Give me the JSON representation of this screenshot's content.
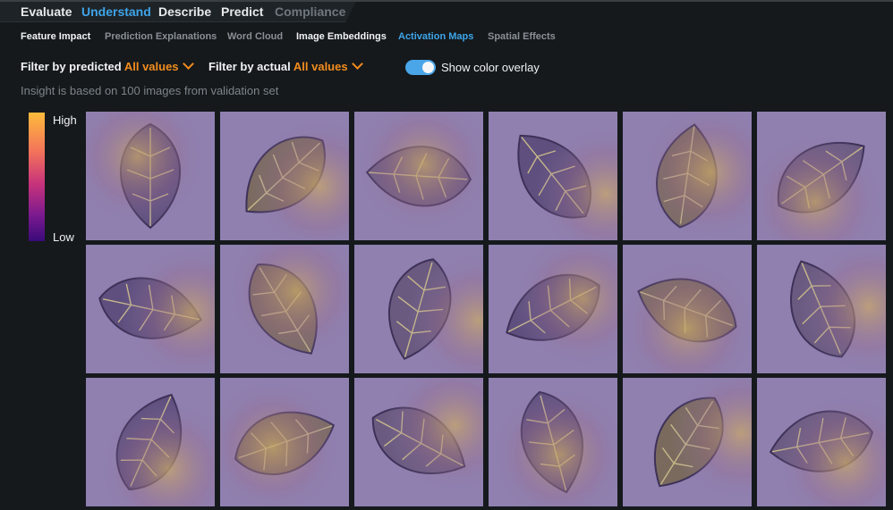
{
  "tabs": [
    {
      "label": "Evaluate",
      "state": "normal"
    },
    {
      "label": "Understand",
      "state": "active"
    },
    {
      "label": "Describe",
      "state": "normal"
    },
    {
      "label": "Predict",
      "state": "normal"
    },
    {
      "label": "Compliance",
      "state": "disabled"
    }
  ],
  "subtabs": [
    {
      "label": "Feature Impact",
      "state": "normal"
    },
    {
      "label": "Prediction Explanations",
      "state": "muted"
    },
    {
      "label": "Word Cloud",
      "state": "muted"
    },
    {
      "label": "Image Embeddings",
      "state": "normal"
    },
    {
      "label": "Activation Maps",
      "state": "active"
    },
    {
      "label": "Spatial Effects",
      "state": "muted"
    }
  ],
  "filters": {
    "predicted_label": "Filter by predicted",
    "predicted_value": "All values",
    "actual_label": "Filter by actual",
    "actual_value": "All values"
  },
  "overlay_toggle": {
    "label": "Show color overlay",
    "on": true
  },
  "insight_text": "Insight is based on 100 images from validation set",
  "legend": {
    "high": "High",
    "low": "Low"
  },
  "colors": {
    "accent": "#3ea5ea",
    "filter_value": "#f28c1e",
    "toggle_on": "#4aa6e8"
  },
  "images": [
    {
      "name": "leaf-image"
    },
    {
      "name": "leaf-image"
    },
    {
      "name": "leaf-image"
    },
    {
      "name": "leaf-image"
    },
    {
      "name": "leaf-image"
    },
    {
      "name": "leaf-image"
    },
    {
      "name": "leaf-image"
    },
    {
      "name": "leaf-image"
    },
    {
      "name": "leaf-image"
    },
    {
      "name": "leaf-image"
    },
    {
      "name": "leaf-image"
    },
    {
      "name": "leaf-image"
    },
    {
      "name": "leaf-image"
    },
    {
      "name": "leaf-image"
    },
    {
      "name": "leaf-image"
    },
    {
      "name": "leaf-image"
    },
    {
      "name": "leaf-image"
    },
    {
      "name": "leaf-image"
    }
  ]
}
